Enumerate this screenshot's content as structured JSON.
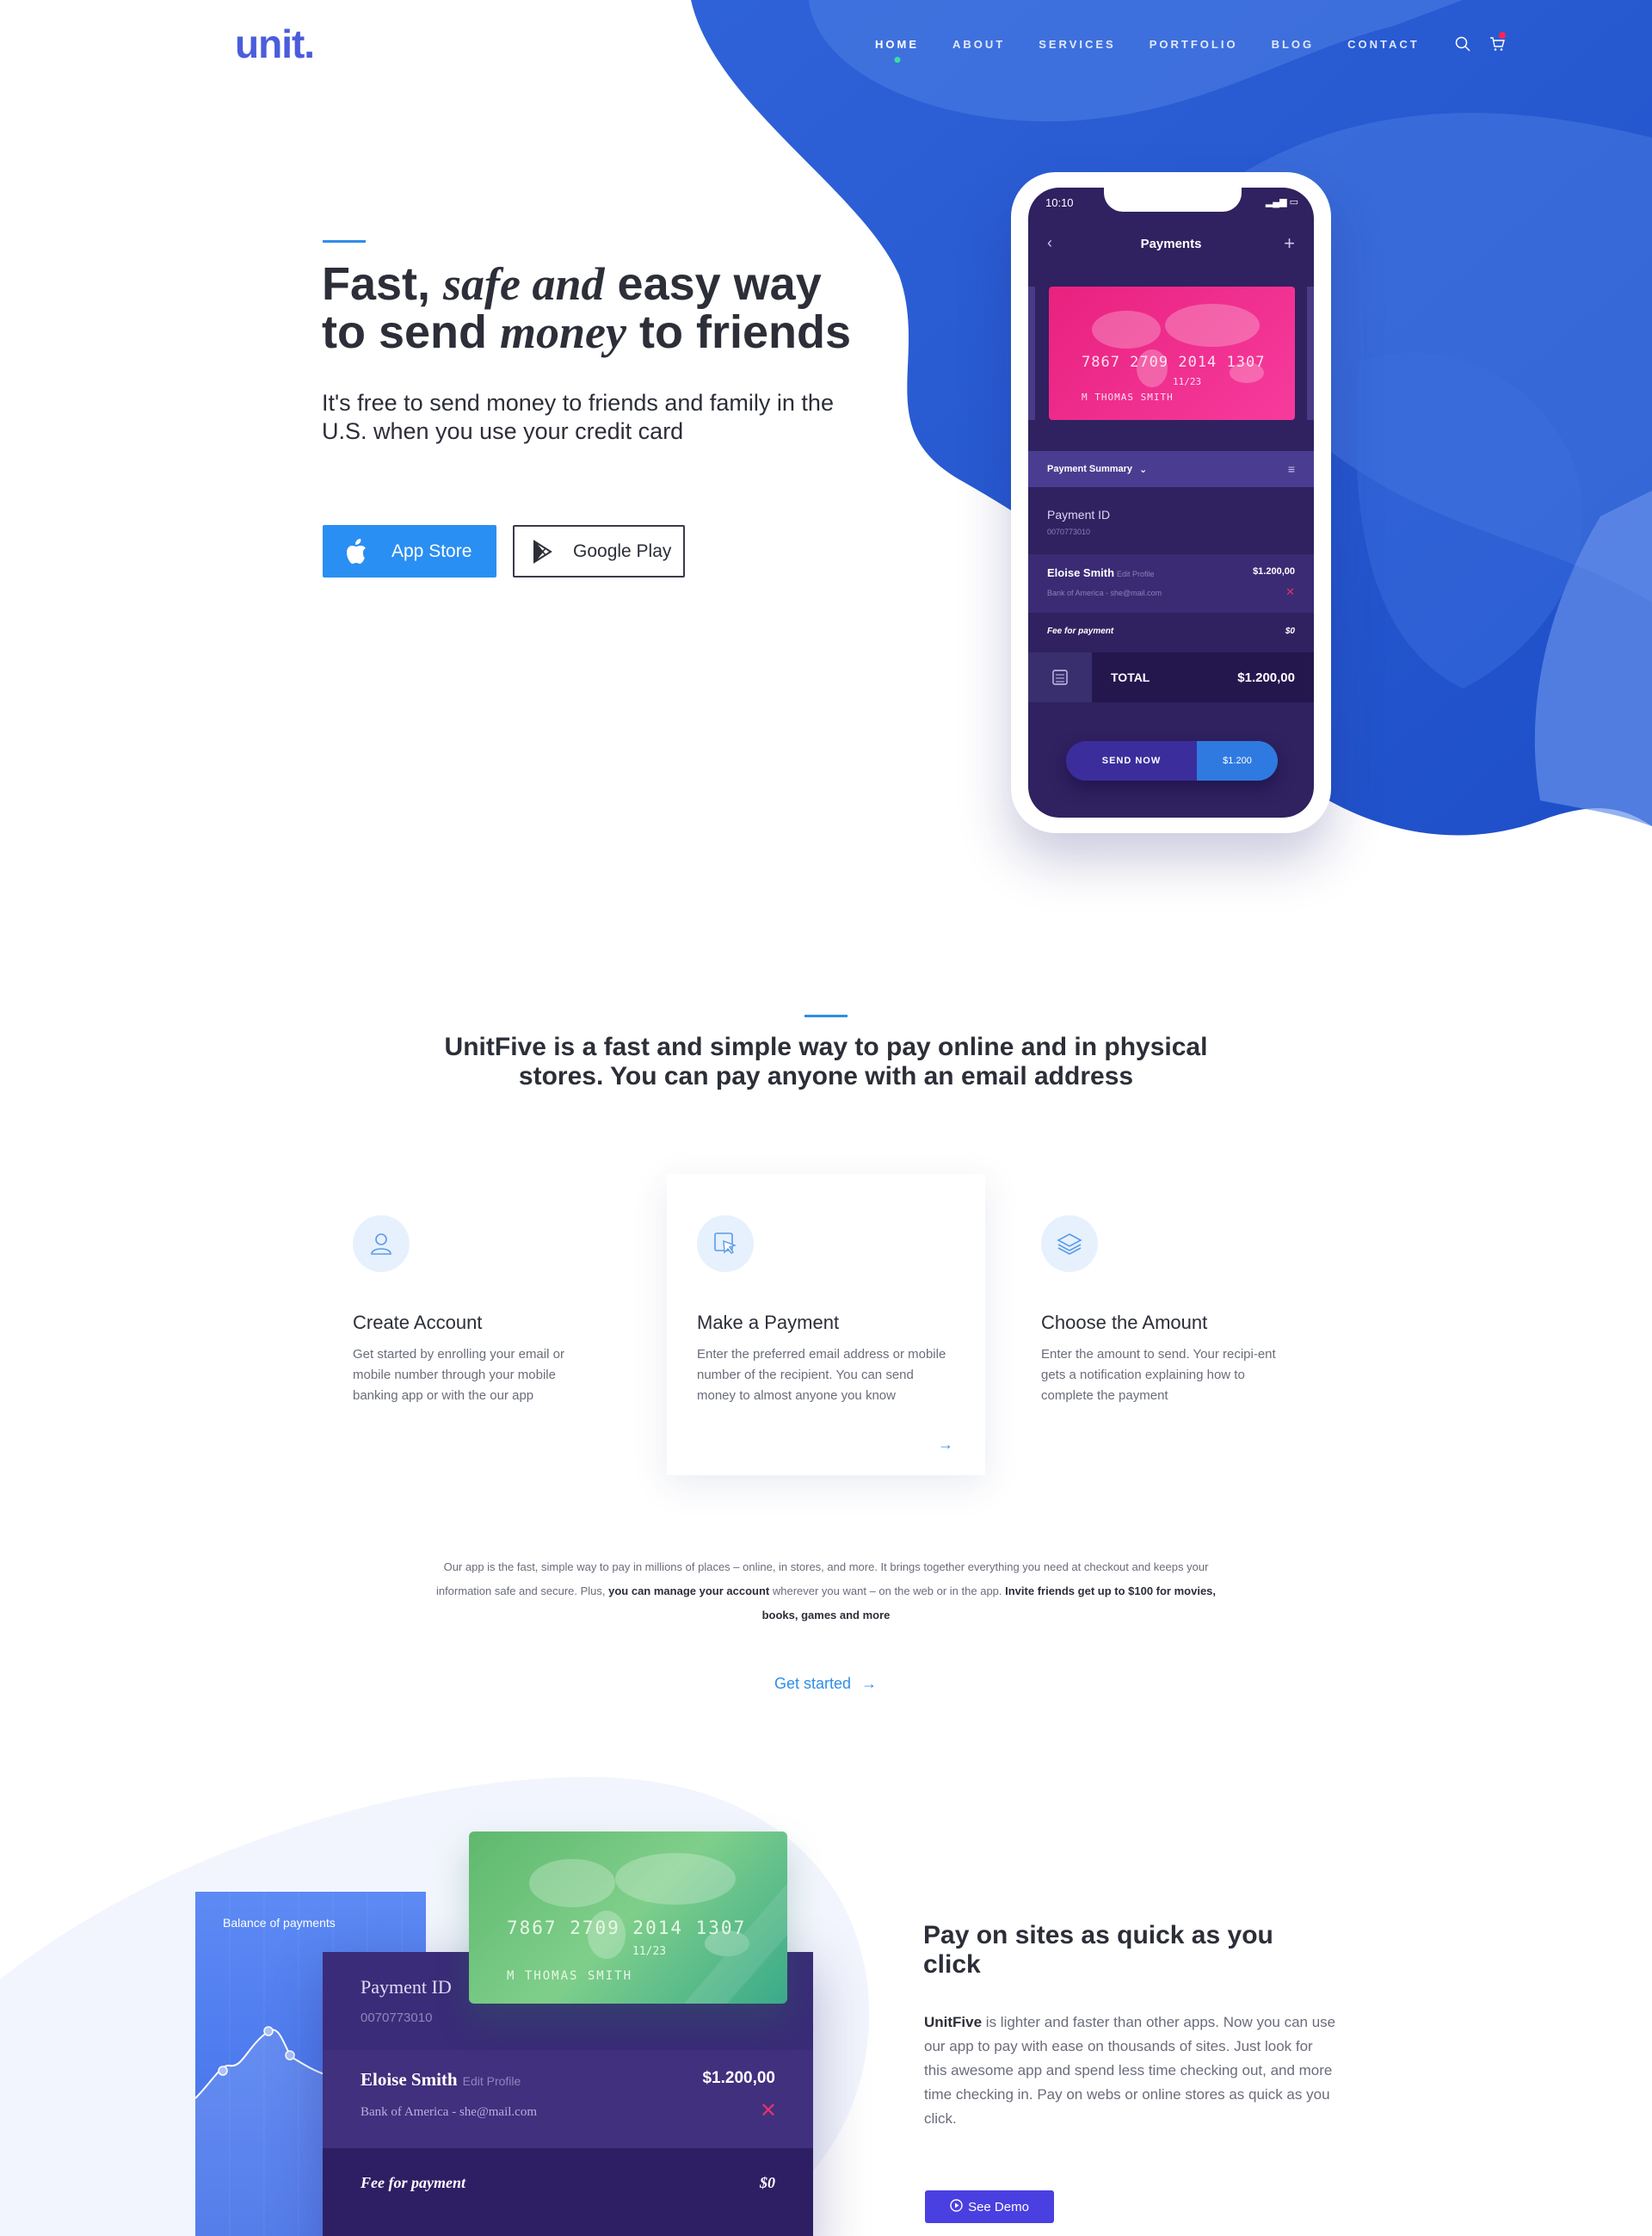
{
  "header": {
    "logo": "unit.",
    "nav": [
      {
        "label": "HOME"
      },
      {
        "label": "ABOUT"
      },
      {
        "label": "SERVICES"
      },
      {
        "label": "PORTFOLIO"
      },
      {
        "label": "BLOG"
      },
      {
        "label": "CONTACT"
      }
    ],
    "active_nav": "HOME",
    "icons": [
      "search-icon",
      "cart-icon"
    ]
  },
  "hero": {
    "title_part1": "Fast, ",
    "title_italic1": "safe and",
    "title_part2": " easy way",
    "title_part3": "to send ",
    "title_italic2": "money",
    "title_part4": " to friends",
    "subtitle": "It's free to send money to friends and family in the U.S. when you use your credit card",
    "app_store_label": "App Store",
    "google_play_label": "Google Play"
  },
  "phone": {
    "time": "10:10",
    "screen_title": "Payments",
    "card_number": "7867 2709 2014 1307",
    "card_expiry": "11/23",
    "card_holder": "M THOMAS SMITH",
    "summary_label": "Payment Summary",
    "payment_id_label": "Payment ID",
    "payment_id": "0070773010",
    "payee_name": "Eloise Smith",
    "payee_edit": "Edit Profile",
    "payee_bank": "Bank of America - she@mail.com",
    "payee_amount": "$1.200,00",
    "fee_label": "Fee for payment",
    "fee_value": "$0",
    "total_label": "TOTAL",
    "total_amount": "$1.200,00",
    "send_label": "SEND NOW",
    "send_amount": "$1.200"
  },
  "intro": {
    "title": "UnitFive is a fast and simple way to pay online and in physical stores. You can pay anyone with an email address"
  },
  "features": [
    {
      "icon": "user-icon",
      "title": "Create Account",
      "text": "Get started by enrolling your email or mobile number through your mobile banking app or with the our app"
    },
    {
      "icon": "cursor-click-icon",
      "title": "Make a Payment",
      "text": "Enter the preferred email address or mobile number of the recipient. You can send money to almost anyone you know"
    },
    {
      "icon": "layers-icon",
      "title": "Choose the Amount",
      "text": "Enter the amount to send. Your recipi-ent gets a notification explaining how to complete the payment"
    }
  ],
  "paragraph": {
    "text1": "Our app is the fast, simple way to pay in millions of places – online, in stores, and more. It brings together everything you need at checkout and keeps your information safe and secure. Plus, ",
    "bold1": "you can manage your account",
    "text2": " wherever you want – on the web or in the app. ",
    "bold2": "Invite friends get up to $100 for movies, books, games and more"
  },
  "get_started_label": "Get started",
  "section3": {
    "balance_title": "Balance of payments",
    "payment_id_label": "Payment ID",
    "payment_id": "0070773010",
    "payee_name": "Eloise Smith",
    "payee_edit": "Edit Profile",
    "payee_bank": "Bank of America - she@mail.com",
    "payee_amount": "$1.200,00",
    "fee_label": "Fee for payment",
    "fee_value": "$0",
    "card_number": "7867 2709 2014 1307",
    "card_expiry": "11/23",
    "card_holder": "M THOMAS SMITH",
    "title": "Pay on sites as quick as you click",
    "text_bold": "UnitFive",
    "text": " is lighter and faster than other apps. Now you can use our app to pay with ease on thousands of sites. Just look for this awesome app and spend less time checking out, and more time checking in. Pay on webs or online stores as quick as you click.",
    "demo_label": "See Demo"
  },
  "colors": {
    "brand_blue": "#4a5ddb",
    "accent": "#2f8ee8",
    "purple": "#302160",
    "pink_card": "#e9217f",
    "green_card": "#5fb86e",
    "demo_button": "#4a3fe0"
  }
}
